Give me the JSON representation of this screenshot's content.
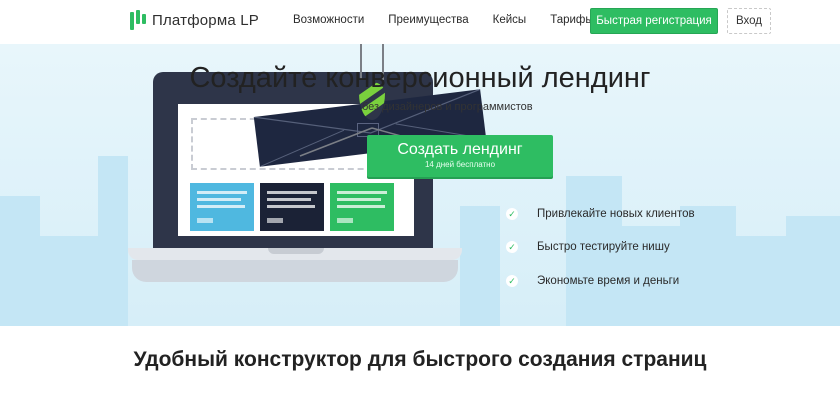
{
  "header": {
    "logo_text": "Платформа LP",
    "nav": [
      "Возможности",
      "Преимущества",
      "Кейсы",
      "Тарифы"
    ],
    "register_button": "Быстрая регистрация",
    "login_button": "Вход"
  },
  "hero": {
    "title": "Создайте конверсионный лендинг",
    "subtitle": "без дизайнеров и программистов",
    "cta_title": "Создать лендинг",
    "cta_subtitle": "14 дней бесплатно",
    "features": [
      "Привлекайте новых клиентов",
      "Быстро тестируйте нишу",
      "Экономьте время и деньги"
    ]
  },
  "section": {
    "title": "Удобный конструктор для быстрого создания страниц"
  },
  "colors": {
    "accent": "#2ebd62",
    "dark": "#1e2740",
    "light_blue": "#4fb8e0"
  }
}
